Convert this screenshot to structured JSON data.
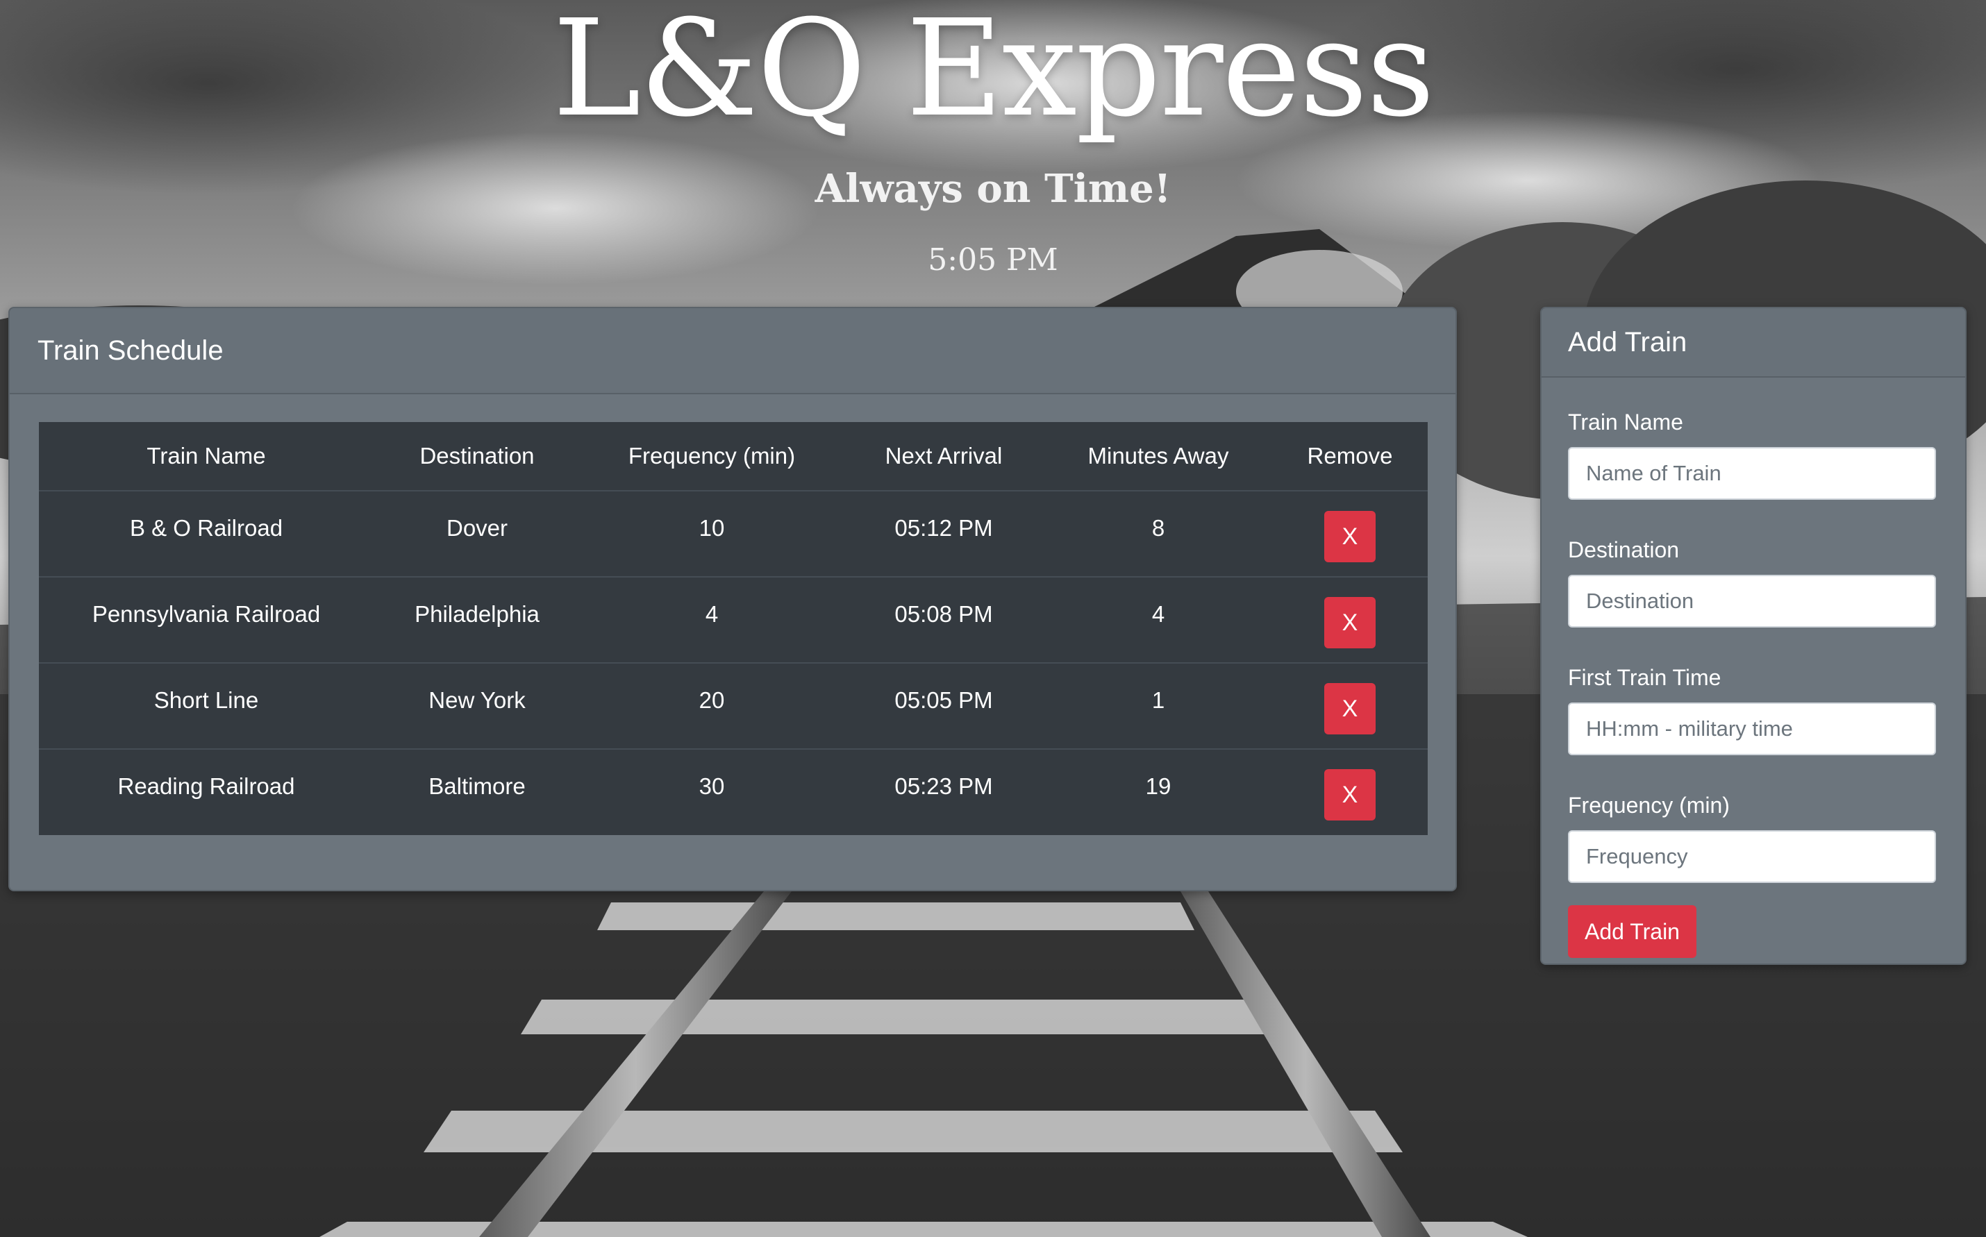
{
  "header": {
    "title": "L&Q Express",
    "tagline": "Always on Time!",
    "current_time": "5:05 PM"
  },
  "schedule": {
    "title": "Train Schedule",
    "columns": [
      "Train Name",
      "Destination",
      "Frequency (min)",
      "Next Arrival",
      "Minutes Away",
      "Remove"
    ],
    "rows": [
      {
        "train_name": "B & O Railroad",
        "destination": "Dover",
        "frequency": "10",
        "next_arrival": "05:12 PM",
        "minutes_away": "8",
        "remove_label": "X"
      },
      {
        "train_name": "Pennsylvania Railroad",
        "destination": "Philadelphia",
        "frequency": "4",
        "next_arrival": "05:08 PM",
        "minutes_away": "4",
        "remove_label": "X"
      },
      {
        "train_name": "Short Line",
        "destination": "New York",
        "frequency": "20",
        "next_arrival": "05:05 PM",
        "minutes_away": "1",
        "remove_label": "X"
      },
      {
        "train_name": "Reading Railroad",
        "destination": "Baltimore",
        "frequency": "30",
        "next_arrival": "05:23 PM",
        "minutes_away": "19",
        "remove_label": "X"
      }
    ]
  },
  "add_train": {
    "title": "Add Train",
    "fields": [
      {
        "label": "Train Name",
        "placeholder": "Name of Train",
        "value": ""
      },
      {
        "label": "Destination",
        "placeholder": "Destination",
        "value": ""
      },
      {
        "label": "First Train Time",
        "placeholder": "HH:mm - military time",
        "value": ""
      },
      {
        "label": "Frequency (min)",
        "placeholder": "Frequency",
        "value": ""
      }
    ],
    "submit_label": "Add Train"
  },
  "colors": {
    "card_bg": "#6c757d",
    "table_bg": "#343a40",
    "danger": "#dc3545"
  }
}
